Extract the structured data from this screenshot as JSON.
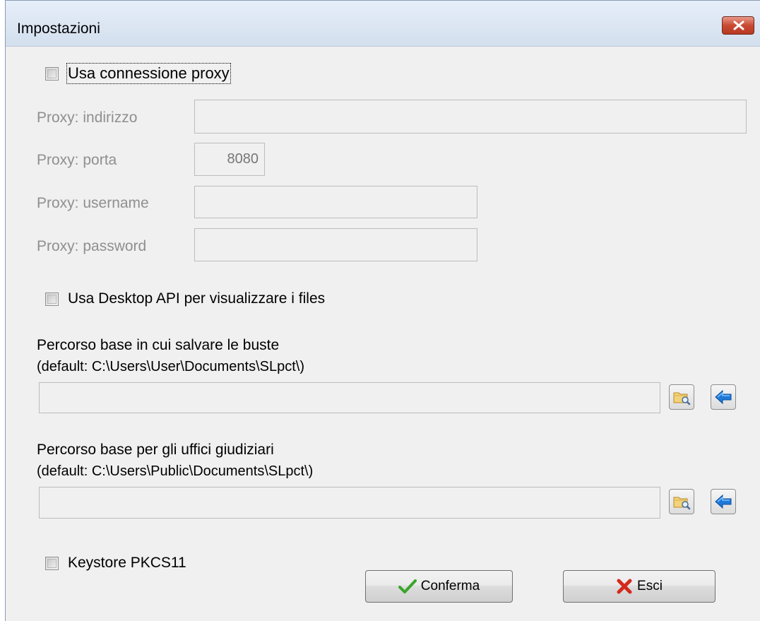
{
  "window": {
    "title": "Impostazioni"
  },
  "proxy": {
    "checkbox_label": "Usa connessione proxy",
    "address_label": "Proxy: indirizzo",
    "address_value": "",
    "port_label": "Proxy: porta",
    "port_value": "8080",
    "username_label": "Proxy: username",
    "username_value": "",
    "password_label": "Proxy: password",
    "password_value": ""
  },
  "desktop_api": {
    "checkbox_label": "Usa Desktop API per visualizzare i files"
  },
  "envelopes_path": {
    "label": "Percorso base in cui salvare le buste",
    "default_hint": "(default: C:\\Users\\User\\Documents\\SLpct\\)",
    "value": ""
  },
  "offices_path": {
    "label": "Percorso base per gli uffici giudiziari",
    "default_hint": "(default: C:\\Users\\Public\\Documents\\SLpct\\)",
    "value": ""
  },
  "keystore": {
    "checkbox_label": "Keystore PKCS11"
  },
  "buttons": {
    "confirm_label": "Conferma",
    "exit_label": "Esci"
  },
  "icons": {
    "close": "close-icon",
    "browse": "folder-browse-icon",
    "reset": "arrow-left-icon",
    "confirm": "checkmark-icon",
    "exit": "cross-icon"
  },
  "colors": {
    "close_button": "#c94a32",
    "confirm_check": "#3aa52a",
    "exit_cross": "#d42a1c",
    "arrow_blue": "#1e78d8"
  }
}
